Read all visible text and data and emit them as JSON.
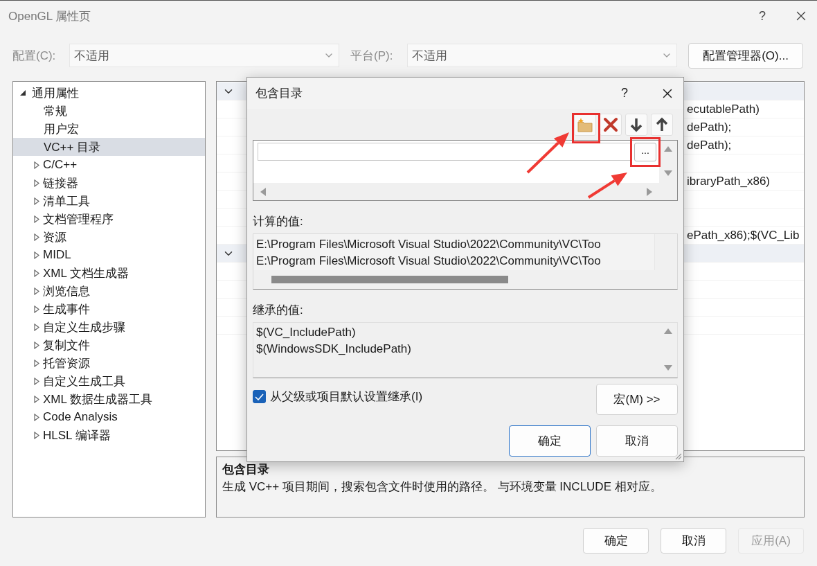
{
  "window": {
    "title": "OpenGL 属性页",
    "help": "?"
  },
  "config": {
    "label": "配置(C):",
    "value": "不适用"
  },
  "platform": {
    "label": "平台(P):",
    "value": "不适用"
  },
  "config_manager_button": "配置管理器(O)...",
  "tree": [
    {
      "label": "通用属性",
      "expanded": true,
      "selected": false,
      "children": [
        {
          "label": "常规",
          "selected": false
        },
        {
          "label": "用户宏",
          "selected": false
        },
        {
          "label": "VC++ 目录",
          "selected": true
        }
      ]
    },
    {
      "label": "C/C++",
      "expanded": false,
      "selected": false
    },
    {
      "label": "链接器",
      "expanded": false,
      "selected": false
    },
    {
      "label": "清单工具",
      "expanded": false,
      "selected": false
    },
    {
      "label": "文档管理程序",
      "expanded": false,
      "selected": false
    },
    {
      "label": "资源",
      "expanded": false,
      "selected": false
    },
    {
      "label": "MIDL",
      "expanded": false,
      "selected": false
    },
    {
      "label": "XML 文档生成器",
      "expanded": false,
      "selected": false
    },
    {
      "label": "浏览信息",
      "expanded": false,
      "selected": false
    },
    {
      "label": "生成事件",
      "expanded": false,
      "selected": false
    },
    {
      "label": "自定义生成步骤",
      "expanded": false,
      "selected": false
    },
    {
      "label": "复制文件",
      "expanded": false,
      "selected": false
    },
    {
      "label": "托管资源",
      "expanded": false,
      "selected": false
    },
    {
      "label": "自定义生成工具",
      "expanded": false,
      "selected": false
    },
    {
      "label": "XML 数据生成器工具",
      "expanded": false,
      "selected": false
    },
    {
      "label": "Code Analysis",
      "expanded": false,
      "selected": false
    },
    {
      "label": "HLSL 编译器",
      "expanded": false,
      "selected": false
    }
  ],
  "property_grid": {
    "rows": [
      {
        "kind": "section",
        "expanded": true
      },
      {
        "kind": "property",
        "value": "ecutablePath)"
      },
      {
        "kind": "property",
        "value": "dePath);"
      },
      {
        "kind": "property",
        "value": "dePath);"
      },
      {
        "kind": "property"
      },
      {
        "kind": "property",
        "value": "ibraryPath_x86)"
      },
      {
        "kind": "property"
      },
      {
        "kind": "property"
      },
      {
        "kind": "property",
        "value": "ePath_x86);$(VC_Lib"
      },
      {
        "kind": "section",
        "expanded": true
      },
      {
        "kind": "property"
      },
      {
        "kind": "property"
      },
      {
        "kind": "property"
      },
      {
        "kind": "property"
      }
    ]
  },
  "description": {
    "title": "包含目录",
    "text": "生成 VC++ 项目期间，搜索包含文件时使用的路径。 与环境变量 INCLUDE 相对应。"
  },
  "buttons": [
    {
      "label": "确定",
      "disabled": false
    },
    {
      "label": "取消",
      "disabled": false
    },
    {
      "label": "应用(A)",
      "disabled": true
    }
  ],
  "dialog": {
    "title": "包含目录",
    "help": "?",
    "browse_button": "...",
    "computed_label": "计算的值:",
    "computed_values": [
      "E:\\Program Files\\Microsoft Visual Studio\\2022\\Community\\VC\\Too",
      "E:\\Program Files\\Microsoft Visual Studio\\2022\\Community\\VC\\Too"
    ],
    "inherited_label": "继承的值:",
    "inherited_values": [
      "$(VC_IncludePath)",
      "$(WindowsSDK_IncludePath)"
    ],
    "inherit": {
      "label": "从父级或项目默认设置继承(I)",
      "checked": true
    },
    "macro_button": "宏(M) >>",
    "buttons": [
      {
        "label": "确定",
        "default": true
      },
      {
        "label": "取消",
        "default": false
      }
    ]
  }
}
